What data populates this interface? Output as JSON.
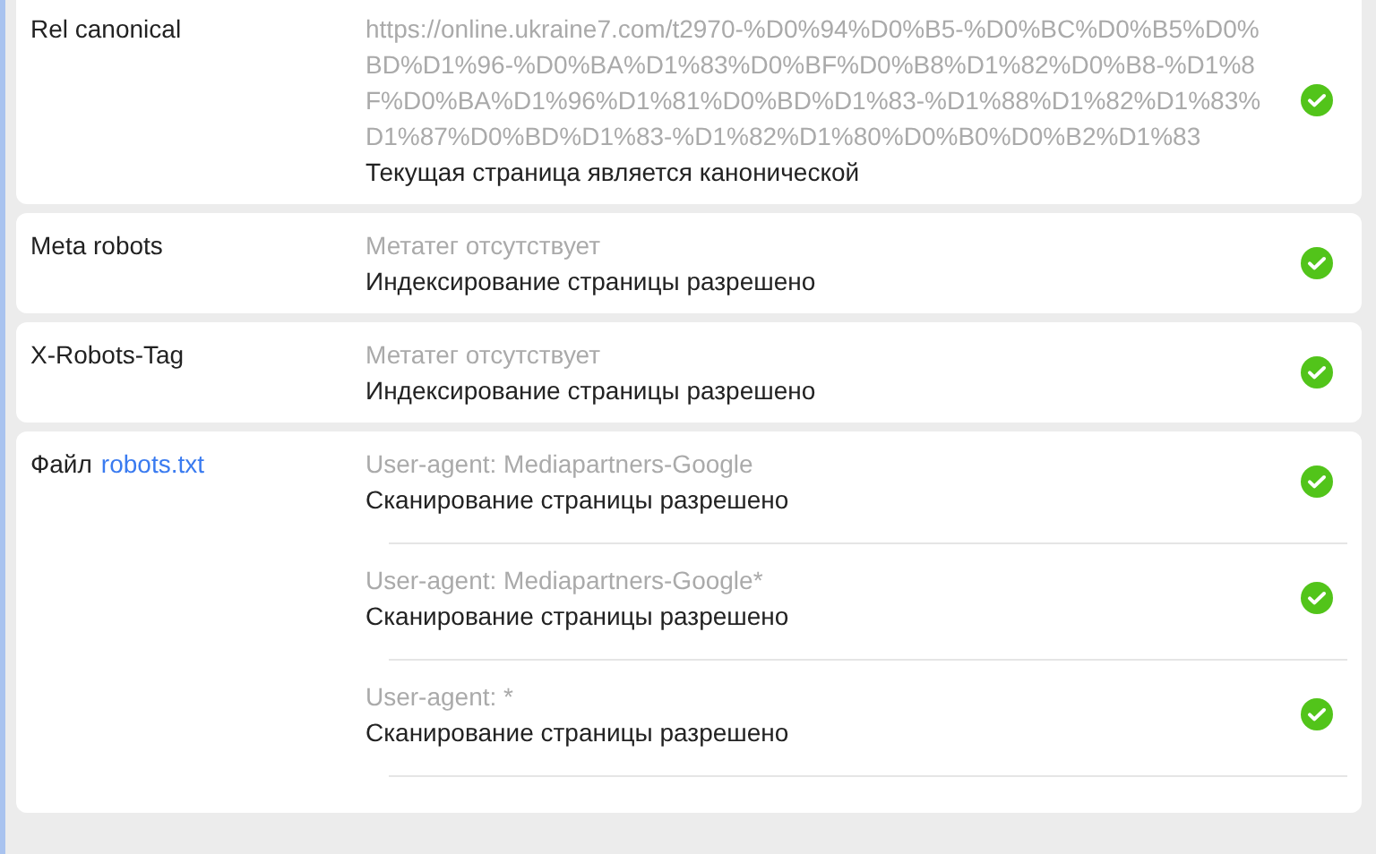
{
  "checks": [
    {
      "label": "Rel canonical",
      "rows": [
        {
          "detail": "https://online.ukraine7.com/t2970-%D0%94%D0%B5-%D0%BC%D0%B5%D0%BD%D1%96-%D0%BA%D1%83%D0%BF%D0%B8%D1%82%D0%B8-%D1%8F%D0%BA%D1%96%D1%81%D0%BD%D1%83-%D1%88%D1%82%D1%83%D1%87%D0%BD%D1%83-%D1%82%D1%80%D0%B0%D0%B2%D1%83",
          "verdict": "Текущая страница является канонической",
          "kind": "ok"
        }
      ]
    },
    {
      "label": "Meta robots",
      "rows": [
        {
          "detail": "Метатег отсутствует",
          "verdict": "Индексирование страницы разрешено",
          "kind": "ok"
        }
      ]
    },
    {
      "label": "X-Robots-Tag",
      "rows": [
        {
          "detail": "Метатег отсутствует",
          "verdict": "Индексирование страницы разрешено",
          "kind": "ok"
        }
      ]
    },
    {
      "label": "Файл",
      "link": "robots.txt",
      "rows": [
        {
          "detail": "User-agent: Mediapartners-Google",
          "verdict": "Сканирование страницы разрешено",
          "kind": "ok"
        },
        {
          "detail": "User-agent: Mediapartners-Google*",
          "verdict": "Сканирование страницы разрешено",
          "kind": "ok"
        },
        {
          "detail": "User-agent: *",
          "verdict": "Сканирование страницы разрешено",
          "kind": "ok"
        }
      ]
    }
  ]
}
